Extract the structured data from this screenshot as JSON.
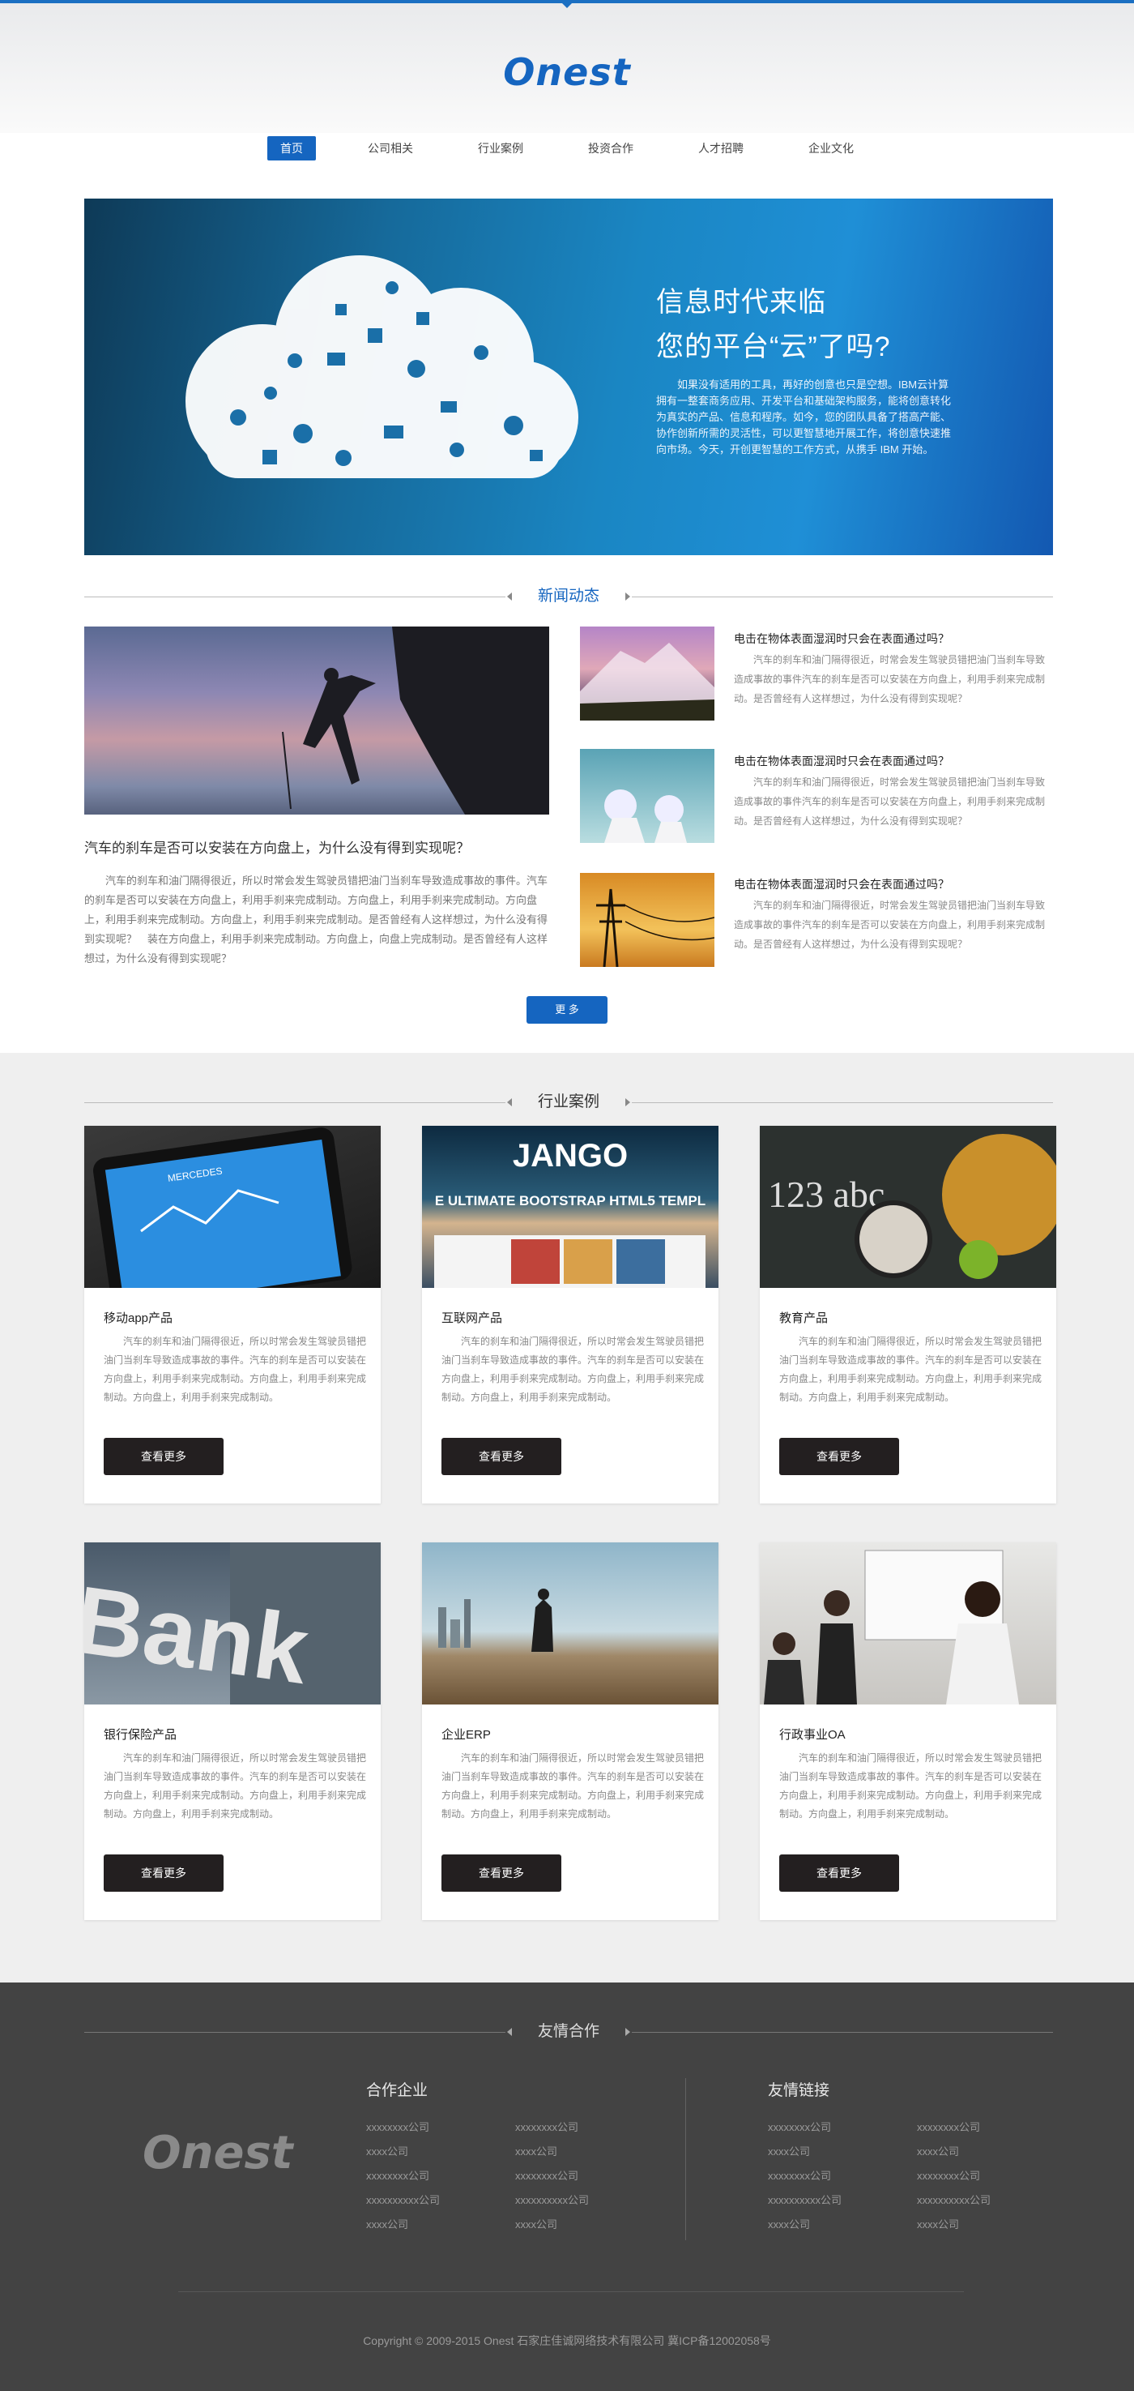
{
  "brand": {
    "logo": "Onest",
    "footer_logo": "Onest"
  },
  "nav": {
    "items": [
      "首页",
      "公司相关",
      "行业案例",
      "投资合作",
      "人才招聘",
      "企业文化"
    ],
    "active": 0
  },
  "banner": {
    "title1": "信息时代来临",
    "title2": "您的平台“云”了吗?",
    "text": "如果没有适用的工具，再好的创意也只是空想。IBM云计算拥有一整套商务应用、开发平台和基础架构服务，能将创意转化为真实的产品、信息和程序。如今，您的团队具备了搭高产能、协作创新所需的灵活性，可以更智慧地开展工作，将创意快速推向市场。今天，开创更智慧的工作方式，从携手 IBM 开始。"
  },
  "news": {
    "section_title": "新闻动态",
    "featured": {
      "title": "汽车的刹车是否可以安装在方向盘上，为什么没有得到实现呢？",
      "text": "汽车的刹车和油门隔得很近，所以时常会发生驾驶员错把油门当刹车导致造成事故的事件。汽车的刹车是否可以安装在方向盘上，利用手刹来完成制动。方向盘上，利用手刹来完成制动。方向盘上，利用手刹来完成制动。方向盘上，利用手刹来完成制动。是否曾经有人这样想过，为什么没有得到实现呢？　装在方向盘上，利用手刹来完成制动。方向盘上，向盘上完成制动。是否曾经有人这样想过，为什么没有得到实现呢？"
    },
    "items": [
      {
        "title": "电击在物体表面湿润时只会在表面通过吗？",
        "text": "汽车的刹车和油门隔得很近，时常会发生驾驶员错把油门当刹车导致造成事故的事件汽车的刹车是否可以安装在方向盘上，利用手刹来完成制动。是否曾经有人这样想过，为什么没有得到实现呢？"
      },
      {
        "title": "电击在物体表面湿润时只会在表面通过吗？",
        "text": "汽车的刹车和油门隔得很近，时常会发生驾驶员错把油门当刹车导致造成事故的事件汽车的刹车是否可以安装在方向盘上，利用手刹来完成制动。是否曾经有人这样想过，为什么没有得到实现呢？"
      },
      {
        "title": "电击在物体表面湿润时只会在表面通过吗？",
        "text": "汽车的刹车和油门隔得很近，时常会发生驾驶员错把油门当刹车导致造成事故的事件汽车的刹车是否可以安装在方向盘上，利用手刹来完成制动。是否曾经有人这样想过，为什么没有得到实现呢？"
      }
    ],
    "more_label": "更 多"
  },
  "cases": {
    "section_title": "行业案例",
    "card_text": "汽车的刹车和油门隔得很近，所以时常会发生驾驶员错把油门当刹车导致造成事故的事件。汽车的刹车是否可以安装在方向盘上，利用手刹来完成制动。方向盘上，利用手刹来完成制动。方向盘上，利用手刹来完成制动。",
    "button_label": "查看更多",
    "items": [
      {
        "title": "移动app产品",
        "img_text": "MERCEDES"
      },
      {
        "title": "互联网产品",
        "img_text": "JANGO",
        "img_sub": "E ULTIMATE BOOTSTRAP HTML5 TEMPL"
      },
      {
        "title": "教育产品",
        "img_text": "123 abc"
      },
      {
        "title": "银行保险产品",
        "img_text": "Bank"
      },
      {
        "title": "企业ERP"
      },
      {
        "title": "行政事业OA"
      }
    ]
  },
  "footer": {
    "section_title": "友情合作",
    "col1_title": "合作企业",
    "col2_title": "友情链接",
    "links": [
      "xxxxxxxx公司",
      "xxxxxxxx公司",
      "xxxx公司",
      "xxxx公司",
      "xxxxxxxx公司",
      "xxxxxxxx公司",
      "xxxxxxxxxx公司",
      "xxxxxxxxxx公司",
      "xxxx公司",
      "xxxx公司"
    ],
    "copyright": "Copyright © 2009-2015   Onest   石家庄佳诚网络技术有限公司   冀ICP备12002058号"
  }
}
